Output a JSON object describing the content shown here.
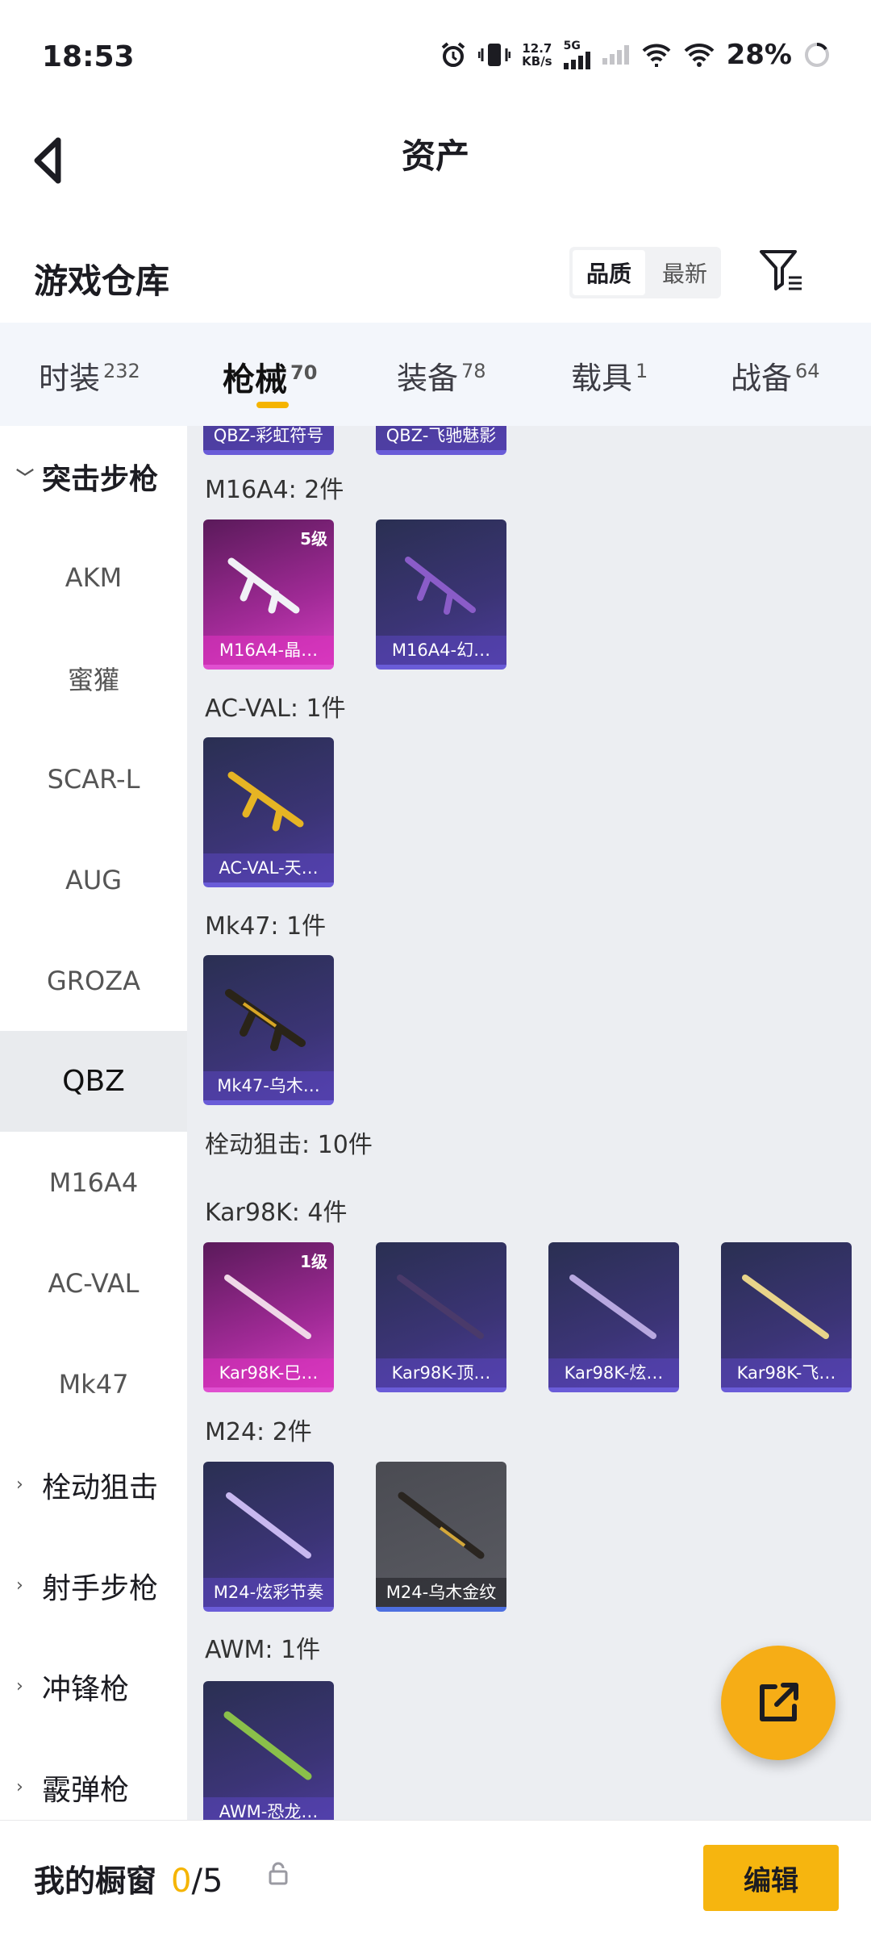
{
  "status": {
    "time": "18:53",
    "speed_value": "12.7",
    "speed_unit": "KB/s",
    "network": "5G",
    "battery": "28%"
  },
  "header": {
    "title": "资产"
  },
  "section": {
    "title": "游戏仓库"
  },
  "sort": {
    "quality": "品质",
    "newest": "最新"
  },
  "tabs": [
    {
      "label": "时装",
      "count": "232"
    },
    {
      "label": "枪械",
      "count": "70"
    },
    {
      "label": "装备",
      "count": "78"
    },
    {
      "label": "载具",
      "count": "1"
    },
    {
      "label": "战备",
      "count": "64"
    }
  ],
  "sidebar": {
    "items": [
      "突击步枪",
      "AKM",
      "蜜獾",
      "SCAR-L",
      "AUG",
      "GROZA",
      "QBZ",
      "M16A4",
      "AC-VAL",
      "Mk47",
      "栓动狙击",
      "射手步枪",
      "冲锋枪",
      "霰弹枪"
    ]
  },
  "content": {
    "partial_cards": [
      "QBZ-彩虹符号",
      "QBZ-飞驰魅影"
    ],
    "m16_title": "M16A4: 2件",
    "m16_cards": [
      {
        "label": "M16A4-晶…",
        "level": "5级"
      },
      {
        "label": "M16A4-幻…"
      }
    ],
    "acval_title": "AC-VAL: 1件",
    "acval_cards": [
      {
        "label": "AC-VAL-天…"
      }
    ],
    "mk47_title": "Mk47: 1件",
    "mk47_cards": [
      {
        "label": "Mk47-乌木…"
      }
    ],
    "bolt_title": "栓动狙击: 10件",
    "kar_title": "Kar98K: 4件",
    "kar_cards": [
      {
        "label": "Kar98K-巳…",
        "level": "1级"
      },
      {
        "label": "Kar98K-顶…"
      },
      {
        "label": "Kar98K-炫…"
      },
      {
        "label": "Kar98K-飞…"
      }
    ],
    "m24_title": "M24: 2件",
    "m24_cards": [
      {
        "label": "M24-炫彩节奏"
      },
      {
        "label": "M24-乌木金纹"
      }
    ],
    "awm_title": "AWM: 1件",
    "awm_cards": [
      {
        "label": "AWM-恐龙…"
      }
    ]
  },
  "bottom": {
    "showcase_label": "我的橱窗",
    "showcase_current": "0",
    "showcase_total": "/5",
    "edit_label": "编辑"
  },
  "colors": {
    "accent": "#f6b50f",
    "content_bg": "#eceef2",
    "tab_bg": "#f3f6fb"
  }
}
